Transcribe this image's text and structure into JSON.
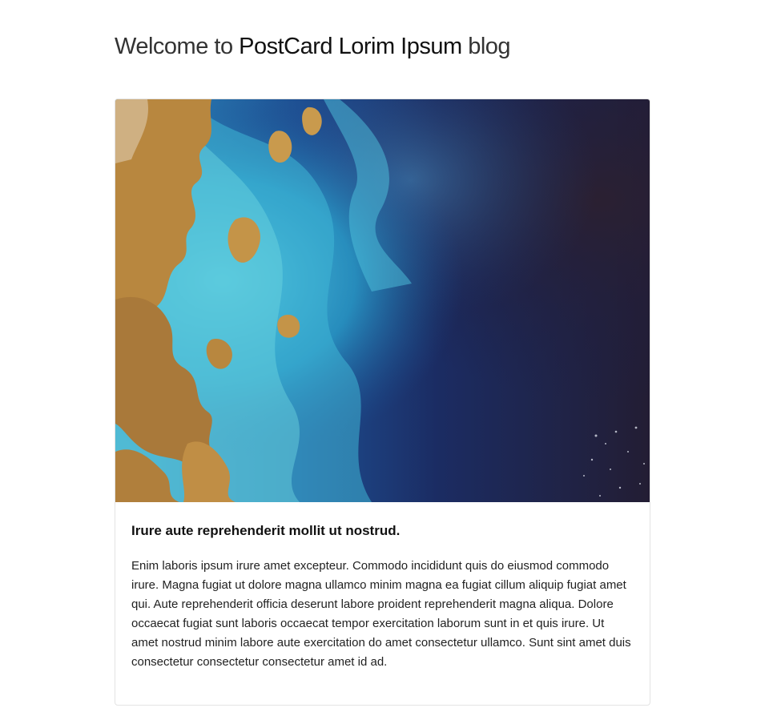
{
  "header": {
    "prefix": "Welcome to",
    "brand": "PostCard Lorim Ipsum",
    "suffix": "blog"
  },
  "post": {
    "image_subject": "satellite-coastline-image",
    "title": "Irure aute reprehenderit mollit ut nostrud.",
    "body": "Enim laboris ipsum irure amet excepteur. Commodo incididunt quis do eiusmod commodo irure. Magna fugiat ut dolore magna ullamco minim magna ea fugiat cillum aliquip fugiat amet qui. Aute reprehenderit officia deserunt labore proident reprehenderit magna aliqua. Dolore occaecat fugiat sunt laboris occaecat tempor exercitation laborum sunt in et quis irure. Ut amet nostrud minim labore aute exercitation do amet consectetur ullamco. Sunt sint amet duis consectetur consectetur consectetur amet id ad."
  },
  "colors": {
    "ocean_deep": "#1c1d3f",
    "ocean_mid": "#1a3a7a",
    "shallow_turquoise": "#3fb6d6",
    "land_ochre": "#b8873f",
    "card_border": "#e3e3e3"
  }
}
